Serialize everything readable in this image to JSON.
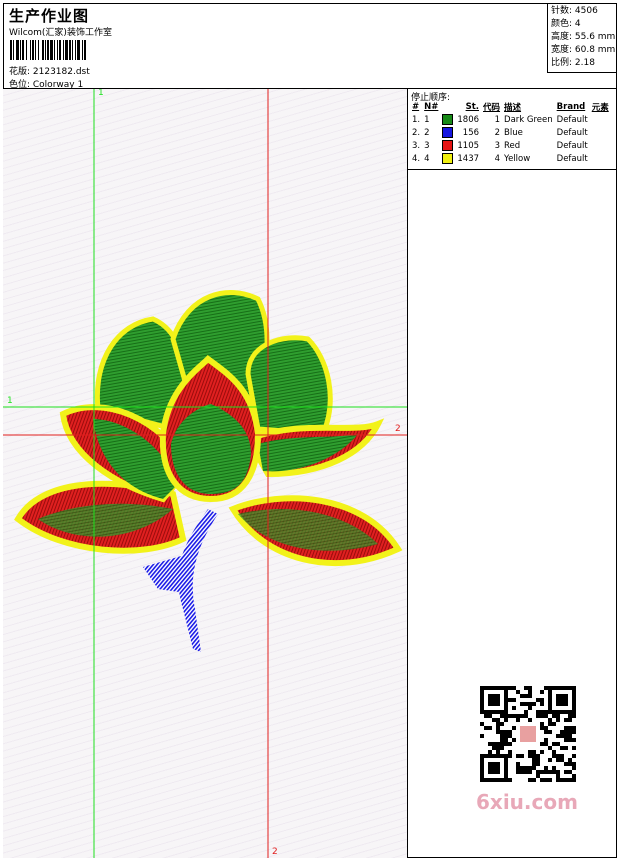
{
  "header": {
    "title": "生产作业图",
    "studio": "Wilcom(汇家)装饰工作室",
    "file_line": "花版: 2123182.dst",
    "colorway_line": "色位: Colorway 1"
  },
  "stats": {
    "stitches": "针数: 4506",
    "colors": "颜色: 4",
    "height": "高度: 55.6 mm",
    "width": "宽度: 60.8 mm",
    "scale": "比例: 2.18"
  },
  "stop_sequence": {
    "title": "停止顺序:",
    "headers": [
      "#",
      "N#",
      "",
      "St.",
      "代码",
      "描述",
      "Brand",
      "元素"
    ],
    "rows": [
      {
        "idx": "1.",
        "n": "1",
        "color": "#178a17",
        "st": "1806",
        "code": "1",
        "desc": "Dark Green",
        "brand": "Default"
      },
      {
        "idx": "2.",
        "n": "2",
        "color": "#1515e0",
        "st": "156",
        "code": "2",
        "desc": "Blue",
        "brand": "Default"
      },
      {
        "idx": "3.",
        "n": "3",
        "color": "#e51414",
        "st": "1105",
        "code": "3",
        "desc": "Red",
        "brand": "Default"
      },
      {
        "idx": "4.",
        "n": "4",
        "color": "#f0f010",
        "st": "1437",
        "code": "4",
        "desc": "Yellow",
        "brand": "Default"
      }
    ]
  },
  "guides": {
    "v1_label": "1",
    "h1_label": "1",
    "h2_label": "2",
    "v2_label": "2",
    "v2_bottom_label": "2"
  },
  "watermark": "6xiu.com",
  "colors": {
    "green_guide": "#1ee01e",
    "red_guide": "#e01e1e",
    "leaf_green": "#2e9a2e",
    "petal_red": "#e02020",
    "stitch_yellow": "#f2f21a",
    "stem_blue": "#1a1ae6"
  }
}
